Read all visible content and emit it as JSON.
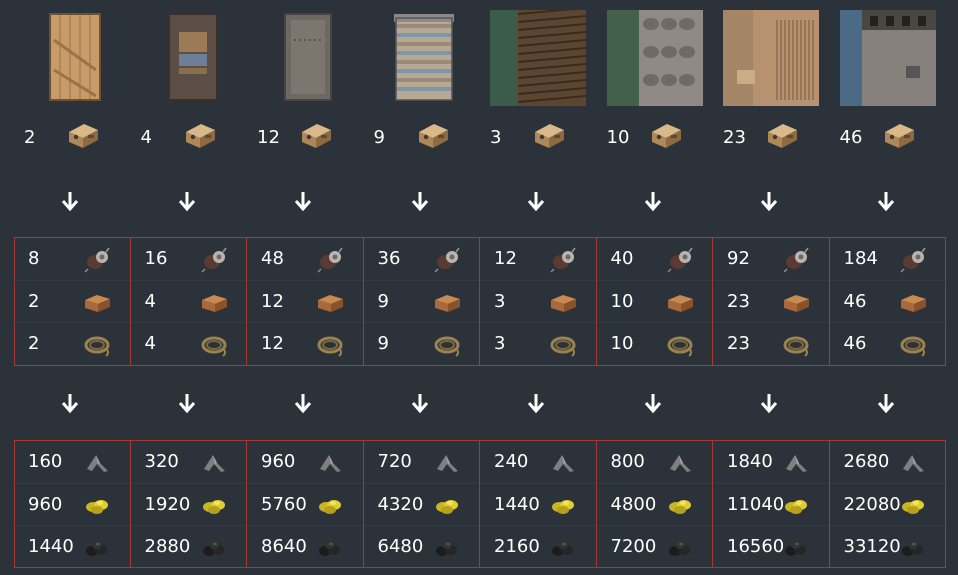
{
  "columns": [
    {
      "name": "wooden-door",
      "icon": "wooden-door-icon",
      "cost": "2",
      "mid": [
        "8",
        "2",
        "2"
      ],
      "out": [
        "160",
        "960",
        "1440"
      ]
    },
    {
      "name": "sheet-metal-door",
      "icon": "sheet-metal-door-icon",
      "cost": "4",
      "mid": [
        "16",
        "4",
        "4"
      ],
      "out": [
        "320",
        "1920",
        "2880"
      ]
    },
    {
      "name": "armored-door",
      "icon": "armored-door-icon",
      "cost": "12",
      "mid": [
        "48",
        "12",
        "12"
      ],
      "out": [
        "960",
        "5760",
        "8640"
      ]
    },
    {
      "name": "garage-door",
      "icon": "garage-door-icon",
      "cost": "9",
      "mid": [
        "36",
        "9",
        "9"
      ],
      "out": [
        "720",
        "4320",
        "6480"
      ]
    },
    {
      "name": "wood-wall",
      "icon": "wood-wall-icon",
      "cost": "3",
      "mid": [
        "12",
        "3",
        "3"
      ],
      "out": [
        "240",
        "1440",
        "2160"
      ]
    },
    {
      "name": "stone-wall",
      "icon": "stone-wall-icon",
      "cost": "10",
      "mid": [
        "40",
        "10",
        "10"
      ],
      "out": [
        "800",
        "4800",
        "7200"
      ]
    },
    {
      "name": "sheet-metal-wall",
      "icon": "sheet-metal-wall-icon",
      "cost": "23",
      "mid": [
        "92",
        "23",
        "23"
      ],
      "out": [
        "1840",
        "11040",
        "16560"
      ]
    },
    {
      "name": "armored-wall",
      "icon": "armored-wall-icon",
      "cost": "46",
      "mid": [
        "184",
        "46",
        "46"
      ],
      "out": [
        "2680",
        "22080",
        "33120"
      ]
    }
  ],
  "icons": {
    "cost": "c4-explosive-icon",
    "mid": [
      "tech-trash-icon",
      "explosives-icon",
      "rope-icon"
    ],
    "out": [
      "metal-fragments-icon",
      "sulfur-icon",
      "charcoal-icon"
    ]
  },
  "colors": {
    "background": "#2b3239",
    "border": "#a53a35",
    "text": "#ffffff"
  }
}
